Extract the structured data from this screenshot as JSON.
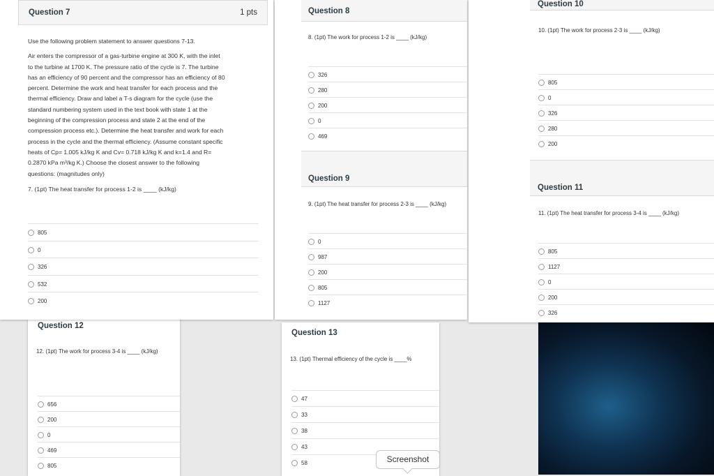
{
  "q7": {
    "title": "Question 7",
    "points": "1 pts",
    "intro": "Use the following problem statement to answer questions 7-13.",
    "statement_lines": [
      "Air enters the compressor of a gas-turbine engine at 300 K, with the inlet",
      "to the turbine at 1700 K. The pressure ratio of the cycle is 7. The turbine",
      "has an efficiency of 90 percent and the compressor has an efficiency of 80",
      "percent. Determine the work and heat transfer for each process and the",
      "thermal efficiency. Draw and label a T-s diagram for the cycle (use the",
      "standard numbering system used in the text book with state 1 at the",
      "beginning of the compression process and state 2 at the end of the",
      "compression process etc.). Determine the heat transfer and work for each",
      "process in the cycle and the thermal efficiency. (Assume constant specific",
      "heats of Cp= 1.005 kJ/kg K and Cv= 0.718 kJ/kg K and k=1.4 and R=",
      "0.2870 kPa m³/kg K.) Choose the closest answer to the following",
      "questions: (magnitudes only)"
    ],
    "prompt": "7. (1pt) The heat transfer for process 1-2 is ____ (kJ/kg)",
    "options": [
      "805",
      "0",
      "326",
      "532",
      "200"
    ]
  },
  "q8": {
    "title": "Question 8",
    "prompt": "8. (1pt) The work for process 1-2 is ____ (kJ/kg)",
    "options": [
      "326",
      "280",
      "200",
      "0",
      "469"
    ]
  },
  "q9": {
    "title": "Question 9",
    "prompt": "9. (1pt) The heat transfer for process 2-3 is ____ (kJ/kg)",
    "options": [
      "0",
      "987",
      "200",
      "805",
      "1127"
    ]
  },
  "q10": {
    "title": "Question 10",
    "prompt": "10. (1pt) The work for process 2-3 is ____ (kJ/kg)",
    "options": [
      "805",
      "0",
      "326",
      "280",
      "200"
    ]
  },
  "q11": {
    "title": "Question 11",
    "prompt": "11. (1pt) The heat transfer for process 3-4 is ____ (kJ/kg)",
    "options": [
      "805",
      "1127",
      "0",
      "200",
      "326"
    ]
  },
  "q12": {
    "title": "Question 12",
    "prompt": "12. (1pt) The work for process 3-4 is ____ (kJ/kg)",
    "options": [
      "656",
      "200",
      "0",
      "469",
      "805"
    ]
  },
  "q13": {
    "title": "Question 13",
    "prompt": "13. (1pt) Thermal efficiency of the cycle is ____%",
    "options": [
      "47",
      "33",
      "38",
      "43",
      "58"
    ]
  },
  "tooltip": "Screenshot"
}
